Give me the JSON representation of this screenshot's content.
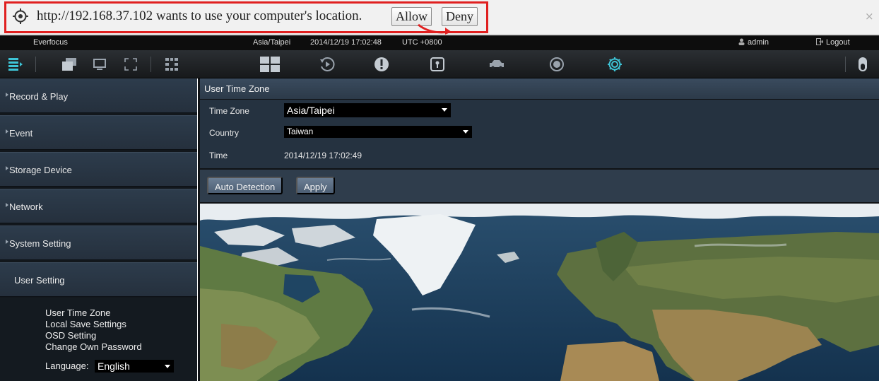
{
  "geolocation_prompt": {
    "message": "http://192.168.37.102 wants to use your computer's location.",
    "allow_label": "Allow",
    "deny_label": "Deny",
    "close_label": "×"
  },
  "status_bar": {
    "brand": "Everfocus",
    "timezone": "Asia/Taipei",
    "datetime": "2014/12/19 17:02:48",
    "utc_offset": "UTC +0800",
    "user": "admin",
    "logout_label": "Logout"
  },
  "toolbar": {
    "active_color": "#3ec4d6",
    "icons": [
      "menu-icon",
      "windows-icon",
      "monitor-icon",
      "fullscreen-icon",
      "layout-icon",
      "grid-icon",
      "playback-icon",
      "alert-icon",
      "lock-icon",
      "car-icon",
      "record-icon",
      "settings-icon",
      "power-icon"
    ]
  },
  "sidebar": {
    "items": [
      {
        "label": "Record & Play"
      },
      {
        "label": "Event"
      },
      {
        "label": "Storage Device"
      },
      {
        "label": "Network"
      },
      {
        "label": "System Setting"
      },
      {
        "label": "User Setting"
      }
    ],
    "submenu": [
      {
        "label": "User Time Zone"
      },
      {
        "label": "Local Save Settings"
      },
      {
        "label": "OSD Setting"
      },
      {
        "label": "Change Own Password"
      }
    ],
    "language_label": "Language:",
    "language_value": "English"
  },
  "panel": {
    "title": "User Time Zone",
    "fields": {
      "time_zone_label": "Time Zone",
      "time_zone_value": "Asia/Taipei",
      "country_label": "Country",
      "country_value": "Taiwan",
      "time_label": "Time",
      "time_value": "2014/12/19 17:02:49"
    },
    "buttons": {
      "auto_detection": "Auto Detection",
      "apply": "Apply"
    }
  },
  "colors": {
    "highlight_border": "#e02020",
    "sidebar_bg": "#2d3c4c",
    "panel_bg": "#253240",
    "button_bg": "#5d7087"
  }
}
